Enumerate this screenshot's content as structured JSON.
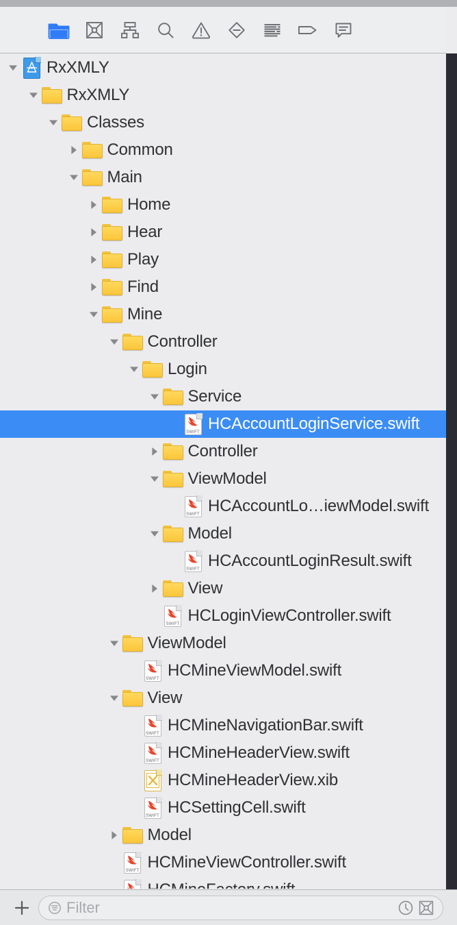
{
  "window": {
    "title": "RxXMLY",
    "navigator_panel": "Project Navigator"
  },
  "toolbar": {
    "items": [
      {
        "name": "project-navigator",
        "icon": "folder-icon",
        "label": "Show the Project navigator",
        "selected": true
      },
      {
        "name": "source-control-navigator",
        "icon": "source-control-icon",
        "label": "Show the Source Control navigator",
        "selected": false
      },
      {
        "name": "symbol-navigator",
        "icon": "symbol-hierarchy-icon",
        "label": "Show the Symbol navigator",
        "selected": false
      },
      {
        "name": "find-navigator",
        "icon": "search-icon",
        "label": "Show the Find navigator",
        "selected": false
      },
      {
        "name": "issue-navigator",
        "icon": "warning-triangle-icon",
        "label": "Show the Issue navigator",
        "selected": false
      },
      {
        "name": "test-navigator",
        "icon": "diamond-minus-icon",
        "label": "Show the Test navigator",
        "selected": false
      },
      {
        "name": "debug-navigator",
        "icon": "debug-gauge-icon",
        "label": "Show the Debug navigator",
        "selected": false
      },
      {
        "name": "breakpoint-navigator",
        "icon": "breakpoint-tag-icon",
        "label": "Show the Breakpoint navigator",
        "selected": false
      },
      {
        "name": "report-navigator",
        "icon": "speech-bubble-icon",
        "label": "Show the Report navigator",
        "selected": false
      }
    ],
    "selected_color": "#2f7cf6"
  },
  "tree": {
    "selected_row_color": "#3b8df5",
    "selected_text_color": "#ffffff",
    "rows": [
      {
        "label": "RxXMLY",
        "depth": 0,
        "icon": "xcode-project-icon",
        "twisty": "down"
      },
      {
        "label": "RxXMLY",
        "depth": 1,
        "icon": "folder-icon",
        "twisty": "down"
      },
      {
        "label": "Classes",
        "depth": 2,
        "icon": "folder-icon",
        "twisty": "down"
      },
      {
        "label": "Common",
        "depth": 3,
        "icon": "folder-icon",
        "twisty": "right"
      },
      {
        "label": "Main",
        "depth": 3,
        "icon": "folder-icon",
        "twisty": "down"
      },
      {
        "label": "Home",
        "depth": 4,
        "icon": "folder-icon",
        "twisty": "right"
      },
      {
        "label": "Hear",
        "depth": 4,
        "icon": "folder-icon",
        "twisty": "right"
      },
      {
        "label": "Play",
        "depth": 4,
        "icon": "folder-icon",
        "twisty": "right"
      },
      {
        "label": "Find",
        "depth": 4,
        "icon": "folder-icon",
        "twisty": "right"
      },
      {
        "label": "Mine",
        "depth": 4,
        "icon": "folder-icon",
        "twisty": "down"
      },
      {
        "label": "Controller",
        "depth": 5,
        "icon": "folder-icon",
        "twisty": "down"
      },
      {
        "label": "Login",
        "depth": 6,
        "icon": "folder-icon",
        "twisty": "down"
      },
      {
        "label": "Service",
        "depth": 7,
        "icon": "folder-icon",
        "twisty": "down"
      },
      {
        "label": "HCAccountLoginService.swift",
        "depth": 8,
        "icon": "swift-file-icon",
        "twisty": "none",
        "selected": true
      },
      {
        "label": "Controller",
        "depth": 7,
        "icon": "folder-icon",
        "twisty": "right"
      },
      {
        "label": "ViewModel",
        "depth": 7,
        "icon": "folder-icon",
        "twisty": "down"
      },
      {
        "label": "HCAccountLo…iewModel.swift",
        "depth": 8,
        "icon": "swift-file-icon",
        "twisty": "none"
      },
      {
        "label": "Model",
        "depth": 7,
        "icon": "folder-icon",
        "twisty": "down"
      },
      {
        "label": "HCAccountLoginResult.swift",
        "depth": 8,
        "icon": "swift-file-icon",
        "twisty": "none"
      },
      {
        "label": "View",
        "depth": 7,
        "icon": "folder-icon",
        "twisty": "right"
      },
      {
        "label": "HCLoginViewController.swift",
        "depth": 7,
        "icon": "swift-file-icon",
        "twisty": "none"
      },
      {
        "label": "ViewModel",
        "depth": 5,
        "icon": "folder-icon",
        "twisty": "down"
      },
      {
        "label": "HCMineViewModel.swift",
        "depth": 6,
        "icon": "swift-file-icon",
        "twisty": "none"
      },
      {
        "label": "View",
        "depth": 5,
        "icon": "folder-icon",
        "twisty": "down"
      },
      {
        "label": "HCMineNavigationBar.swift",
        "depth": 6,
        "icon": "swift-file-icon",
        "twisty": "none"
      },
      {
        "label": "HCMineHeaderView.swift",
        "depth": 6,
        "icon": "swift-file-icon",
        "twisty": "none"
      },
      {
        "label": "HCMineHeaderView.xib",
        "depth": 6,
        "icon": "xib-file-icon",
        "twisty": "none"
      },
      {
        "label": "HCSettingCell.swift",
        "depth": 6,
        "icon": "swift-file-icon",
        "twisty": "none"
      },
      {
        "label": "Model",
        "depth": 5,
        "icon": "folder-icon",
        "twisty": "right"
      },
      {
        "label": "HCMineViewController.swift",
        "depth": 5,
        "icon": "swift-file-icon",
        "twisty": "none"
      },
      {
        "label": "HCMineFactory.swift",
        "depth": 5,
        "icon": "swift-file-icon",
        "twisty": "none"
      }
    ]
  },
  "filter_bar": {
    "add_label": "+",
    "filter_placeholder": "Filter",
    "filter_value": "",
    "filter_icon": "filter-icon",
    "recent_icon": "clock-icon",
    "source_control_icon": "source-control-icon"
  },
  "swift_icon_tag": "SWIFT"
}
